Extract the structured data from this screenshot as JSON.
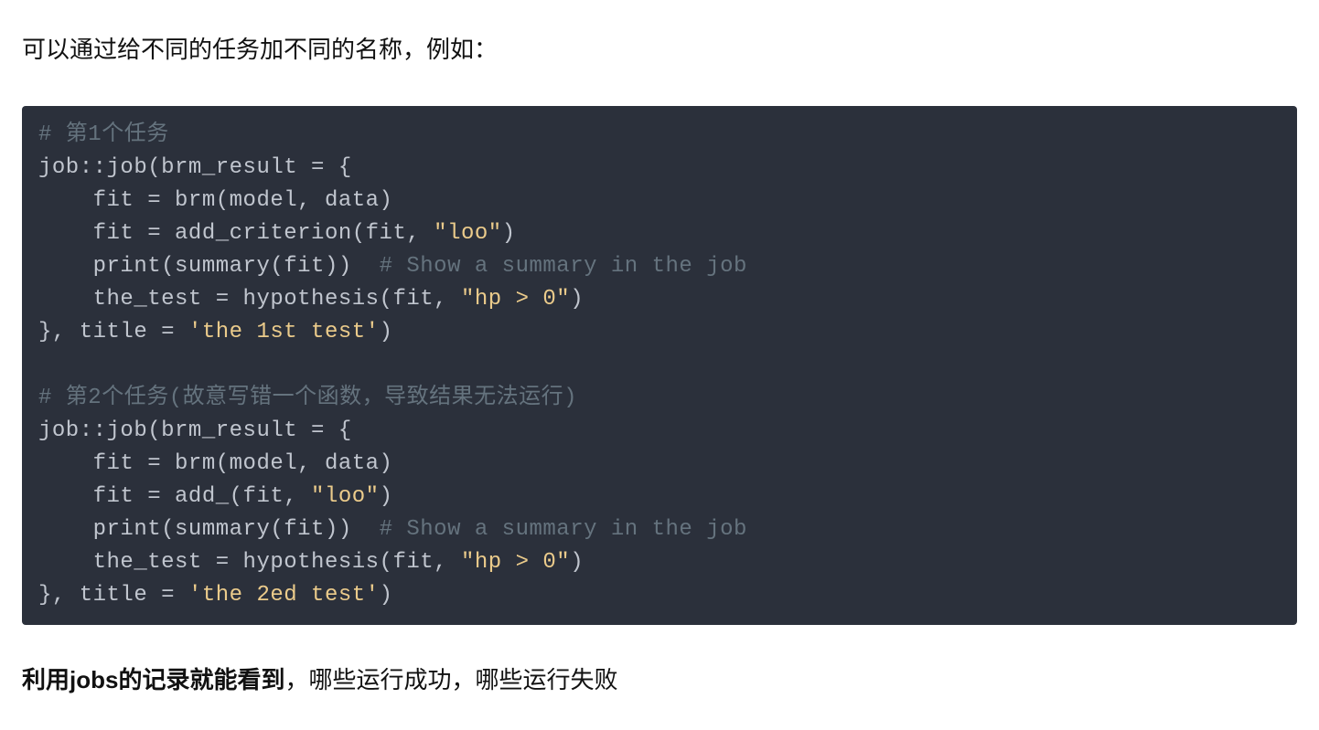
{
  "intro_text": "可以通过给不同的任务加不同的名称，例如：",
  "code": {
    "task1": {
      "comment_header": "# 第1个任务",
      "l1": "job::job(brm_result = {",
      "l2": "    fit = brm(model, data)",
      "l3a": "    fit = add_criterion(fit, ",
      "l3_str": "\"loo\"",
      "l3b": ")",
      "l4a": "    print(summary(fit))  ",
      "l4_comment": "# Show a summary in the job",
      "l5a": "    the_test = hypothesis(fit, ",
      "l5_str": "\"hp > 0\"",
      "l5b": ")",
      "l6a": "}, title = ",
      "l6_str": "'the 1st test'",
      "l6b": ")"
    },
    "blank": " ",
    "task2": {
      "comment_header": "# 第2个任务(故意写错一个函数，导致结果无法运行)",
      "l1": "job::job(brm_result = {",
      "l2": "    fit = brm(model, data)",
      "l3a": "    fit = add_(fit, ",
      "l3_str": "\"loo\"",
      "l3b": ")",
      "l4a": "    print(summary(fit))  ",
      "l4_comment": "# Show a summary in the job",
      "l5a": "    the_test = hypothesis(fit, ",
      "l5_str": "\"hp > 0\"",
      "l5b": ")",
      "l6a": "}, title = ",
      "l6_str": "'the 2ed test'",
      "l6b": ")"
    }
  },
  "outro": {
    "bold": "利用jobs的记录就能看到",
    "rest": "，哪些运行成功，哪些运行失败"
  }
}
